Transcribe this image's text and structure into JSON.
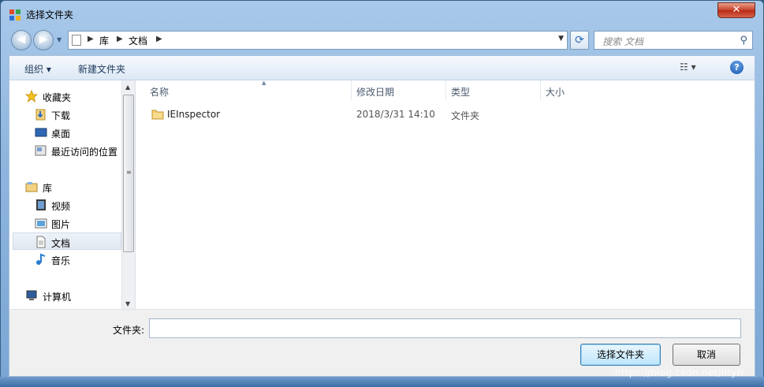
{
  "window": {
    "title": "选择文件夹",
    "close_label": "✕"
  },
  "address_bar": {
    "crumbs": [
      "库",
      "文档"
    ],
    "search_placeholder": "搜索 文档"
  },
  "toolbar": {
    "organize_label": "组织 ▾",
    "new_folder_label": "新建文件夹",
    "view_label": "☷ ▾",
    "help_label": "?"
  },
  "sidebar": {
    "items": [
      {
        "label": "收藏夹",
        "icon": "star-icon",
        "group": "favorites"
      },
      {
        "label": "下载",
        "icon": "download-folder-icon"
      },
      {
        "label": "桌面",
        "icon": "desktop-icon"
      },
      {
        "label": "最近访问的位置",
        "icon": "recent-places-icon"
      },
      {
        "label": "库",
        "icon": "library-icon",
        "group": "libraries"
      },
      {
        "label": "视频",
        "icon": "video-icon"
      },
      {
        "label": "图片",
        "icon": "picture-icon"
      },
      {
        "label": "文档",
        "icon": "document-icon",
        "selected": true
      },
      {
        "label": "音乐",
        "icon": "music-icon"
      },
      {
        "label": "计算机",
        "icon": "computer-icon",
        "group": "computer"
      }
    ]
  },
  "file_list": {
    "columns": [
      "名称",
      "修改日期",
      "类型",
      "大小"
    ],
    "rows": [
      {
        "name": "IEInspector",
        "modified": "2018/3/31 14:10",
        "type": "文件夹",
        "size": ""
      }
    ]
  },
  "footer": {
    "folder_label": "文件夹:",
    "folder_value": "",
    "select_button": "选择文件夹",
    "cancel_button": "取消"
  },
  "watermark": "https://blog.csdn.net/lityfr",
  "colors": {
    "accent": "#3c7fb1",
    "titlebar": "#8fb6df",
    "selection": "#e1e8f1"
  }
}
